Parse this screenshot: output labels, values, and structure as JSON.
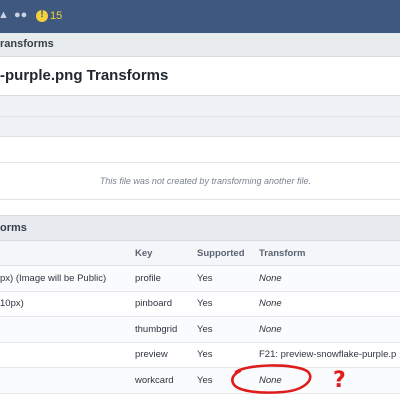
{
  "topbar": {
    "alert_count": "15",
    "icons": [
      "bell-icon",
      "chat-icon",
      "alert-icon"
    ],
    "accent": "#3e5880",
    "alert_color": "#f4d03f"
  },
  "breadcrumb": "ransforms",
  "page_title": "-purple.png Transforms",
  "derived_message": "This file was not created by transforming another file.",
  "section_title": "orms",
  "table": {
    "headers": {
      "key": "Key",
      "supported": "Supported",
      "transform": "Transform"
    },
    "rows": [
      {
        "name": "px) (Image will be Public)",
        "key": "profile",
        "supported": "Yes",
        "transform": "None"
      },
      {
        "name": "10px)",
        "key": "pinboard",
        "supported": "Yes",
        "transform": "None"
      },
      {
        "name": "",
        "key": "thumbgrid",
        "supported": "Yes",
        "transform": "None"
      },
      {
        "name": "",
        "key": "preview",
        "supported": "Yes",
        "transform": "F21: preview-snowflake-purple.p"
      },
      {
        "name": "",
        "key": "workcard",
        "supported": "Yes",
        "transform": "None"
      }
    ]
  },
  "annotation": {
    "mark": "?",
    "color": "#e01b1b"
  }
}
